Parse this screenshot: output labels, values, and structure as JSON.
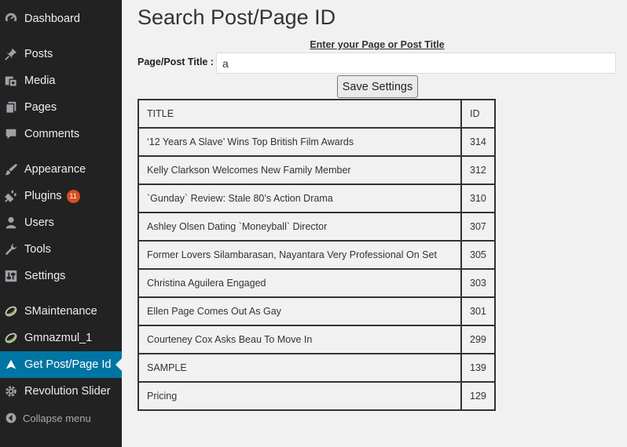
{
  "sidebar": {
    "items": [
      {
        "label": "Dashboard",
        "icon": "dashboard-icon"
      },
      {
        "label": "Posts",
        "icon": "pushpin-icon"
      },
      {
        "label": "Media",
        "icon": "media-icon"
      },
      {
        "label": "Pages",
        "icon": "pages-icon"
      },
      {
        "label": "Comments",
        "icon": "comment-icon"
      },
      {
        "label": "Appearance",
        "icon": "paintbrush-icon"
      },
      {
        "label": "Plugins",
        "icon": "plugin-icon",
        "badge": "11"
      },
      {
        "label": "Users",
        "icon": "user-icon"
      },
      {
        "label": "Tools",
        "icon": "wrench-icon"
      },
      {
        "label": "Settings",
        "icon": "settings-icon"
      },
      {
        "label": "SMaintenance",
        "icon": "ring-icon"
      },
      {
        "label": "Gmnazmul_1",
        "icon": "ring-icon"
      },
      {
        "label": "Get Post/Page Id",
        "icon": "triangle-icon",
        "active": true
      },
      {
        "label": "Revolution Slider",
        "icon": "gear-icon"
      }
    ],
    "collapse_label": "Collapse menu"
  },
  "main": {
    "title": "Search Post/Page ID",
    "instructions": "Enter your Page or Post Title",
    "field_label": "Page/Post Title :",
    "input_value": "a",
    "save_label": "Save Settings",
    "table": {
      "headers": [
        "TITLE",
        "ID"
      ],
      "rows": [
        [
          "‘12 Years A Slave’ Wins Top British Film Awards",
          "314"
        ],
        [
          "Kelly Clarkson Welcomes New Family Member",
          "312"
        ],
        [
          "`Gunday` Review: Stale 80’s Action Drama",
          "310"
        ],
        [
          "Ashley Olsen Dating `Moneyball` Director",
          "307"
        ],
        [
          "Former Lovers Silambarasan, Nayantara Very Professional On Set",
          "305"
        ],
        [
          "Christina Aguilera Engaged",
          "303"
        ],
        [
          "Ellen Page Comes Out As Gay",
          "301"
        ],
        [
          "Courteney Cox Asks Beau To Move In",
          "299"
        ],
        [
          "SAMPLE",
          "139"
        ],
        [
          "Pricing",
          "129"
        ]
      ]
    }
  },
  "colors": {
    "sidebar_bg": "#222222",
    "active_bg": "#0074a2",
    "badge_bg": "#d54e21",
    "content_bg": "#f1f1f1"
  }
}
